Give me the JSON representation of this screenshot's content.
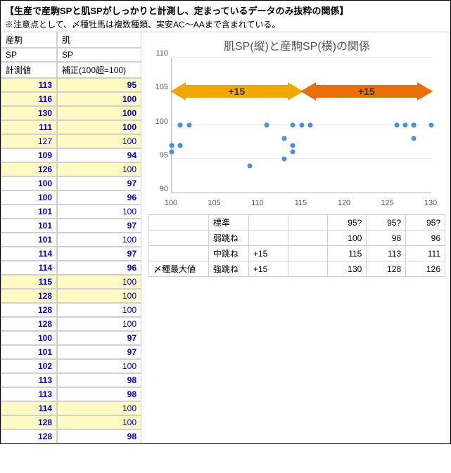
{
  "title": "【生産で産駒SPと肌SPがしっかりと計測し、定まっているデータのみ抜粋の関係】",
  "note": "※注意点として、〆種牡馬は複数種類、実安AC～AAまで含まれている。",
  "headers": {
    "col1_a": "産駒",
    "col2_a": "肌",
    "col1_b": "SP",
    "col2_b": "SP",
    "col1_c": "計測値",
    "col2_c": "補正(100超=100)"
  },
  "rows": [
    {
      "a": "113",
      "b": "95",
      "ay": true,
      "by": true,
      "ab": true,
      "bb": true
    },
    {
      "a": "116",
      "b": "100",
      "ay": true,
      "by": true,
      "ab": true,
      "bb": true
    },
    {
      "a": "130",
      "b": "100",
      "ay": true,
      "by": true,
      "ab": true,
      "bb": true
    },
    {
      "a": "111",
      "b": "100",
      "ay": true,
      "by": true,
      "ab": true,
      "bb": true
    },
    {
      "a": "127",
      "b": "100",
      "ay": true,
      "by": true,
      "ab": false,
      "bb": false
    },
    {
      "a": "109",
      "b": "94",
      "ay": false,
      "by": false,
      "ab": true,
      "bb": true
    },
    {
      "a": "126",
      "b": "100",
      "ay": true,
      "by": true,
      "ab": true,
      "bb": false
    },
    {
      "a": "100",
      "b": "97",
      "ay": false,
      "by": false,
      "ab": true,
      "bb": true
    },
    {
      "a": "100",
      "b": "96",
      "ay": false,
      "by": false,
      "ab": true,
      "bb": true
    },
    {
      "a": "101",
      "b": "100",
      "ay": false,
      "by": false,
      "ab": true,
      "bb": false
    },
    {
      "a": "101",
      "b": "97",
      "ay": false,
      "by": false,
      "ab": true,
      "bb": true
    },
    {
      "a": "101",
      "b": "100",
      "ay": false,
      "by": false,
      "ab": true,
      "bb": false
    },
    {
      "a": "114",
      "b": "97",
      "ay": false,
      "by": false,
      "ab": true,
      "bb": true
    },
    {
      "a": "114",
      "b": "96",
      "ay": false,
      "by": false,
      "ab": true,
      "bb": true
    },
    {
      "a": "115",
      "b": "100",
      "ay": true,
      "by": true,
      "ab": true,
      "bb": false
    },
    {
      "a": "128",
      "b": "100",
      "ay": true,
      "by": true,
      "ab": true,
      "bb": false
    },
    {
      "a": "128",
      "b": "100",
      "ay": false,
      "by": false,
      "ab": true,
      "bb": false
    },
    {
      "a": "128",
      "b": "100",
      "ay": false,
      "by": false,
      "ab": true,
      "bb": false
    },
    {
      "a": "100",
      "b": "97",
      "ay": false,
      "by": false,
      "ab": true,
      "bb": true
    },
    {
      "a": "101",
      "b": "97",
      "ay": false,
      "by": false,
      "ab": true,
      "bb": true
    },
    {
      "a": "102",
      "b": "100",
      "ay": false,
      "by": false,
      "ab": true,
      "bb": false
    },
    {
      "a": "113",
      "b": "98",
      "ay": false,
      "by": false,
      "ab": true,
      "bb": true
    },
    {
      "a": "113",
      "b": "98",
      "ay": false,
      "by": false,
      "ab": true,
      "bb": true
    },
    {
      "a": "114",
      "b": "100",
      "ay": true,
      "by": true,
      "ab": true,
      "bb": false
    },
    {
      "a": "128",
      "b": "100",
      "ay": true,
      "by": true,
      "ab": true,
      "bb": false
    },
    {
      "a": "128",
      "b": "98",
      "ay": false,
      "by": false,
      "ab": true,
      "bb": true
    }
  ],
  "chart_data": {
    "type": "scatter",
    "title": "肌SP(縦)と産駒SP(横)の関係",
    "xlabel": "",
    "ylabel": "",
    "xlim": [
      100,
      130
    ],
    "ylim": [
      90,
      110
    ],
    "xticks": [
      100,
      105,
      110,
      115,
      120,
      125,
      130
    ],
    "yticks": [
      90,
      95,
      100,
      105,
      110
    ],
    "series": [
      {
        "name": "data",
        "points": [
          [
            113,
            95
          ],
          [
            116,
            100
          ],
          [
            130,
            100
          ],
          [
            111,
            100
          ],
          [
            127,
            100
          ],
          [
            109,
            94
          ],
          [
            126,
            100
          ],
          [
            100,
            97
          ],
          [
            100,
            96
          ],
          [
            101,
            100
          ],
          [
            101,
            97
          ],
          [
            101,
            100
          ],
          [
            114,
            97
          ],
          [
            114,
            96
          ],
          [
            115,
            100
          ],
          [
            128,
            100
          ],
          [
            128,
            100
          ],
          [
            128,
            100
          ],
          [
            100,
            97
          ],
          [
            101,
            97
          ],
          [
            102,
            100
          ],
          [
            113,
            98
          ],
          [
            113,
            98
          ],
          [
            114,
            100
          ],
          [
            128,
            100
          ],
          [
            128,
            98
          ]
        ]
      }
    ],
    "arrows": [
      {
        "label": "+15",
        "from": 100,
        "to": 115,
        "color": "gold"
      },
      {
        "label": "+15",
        "from": 115,
        "to": 130,
        "color": "orange"
      }
    ]
  },
  "lower_table": {
    "row_hdr": "〆種最大値",
    "rows": [
      {
        "label": "標準",
        "plus": "",
        "v1": "95?",
        "v2": "95?",
        "v3": "95?"
      },
      {
        "label": "弱跳ね",
        "plus": "",
        "v1": "100",
        "v2": "98",
        "v3": "96"
      },
      {
        "label": "中跳ね",
        "plus": "+15",
        "v1": "115",
        "v2": "113",
        "v3": "111"
      },
      {
        "label": "強跳ね",
        "plus": "+15",
        "v1": "130",
        "v2": "128",
        "v3": "126"
      }
    ]
  }
}
